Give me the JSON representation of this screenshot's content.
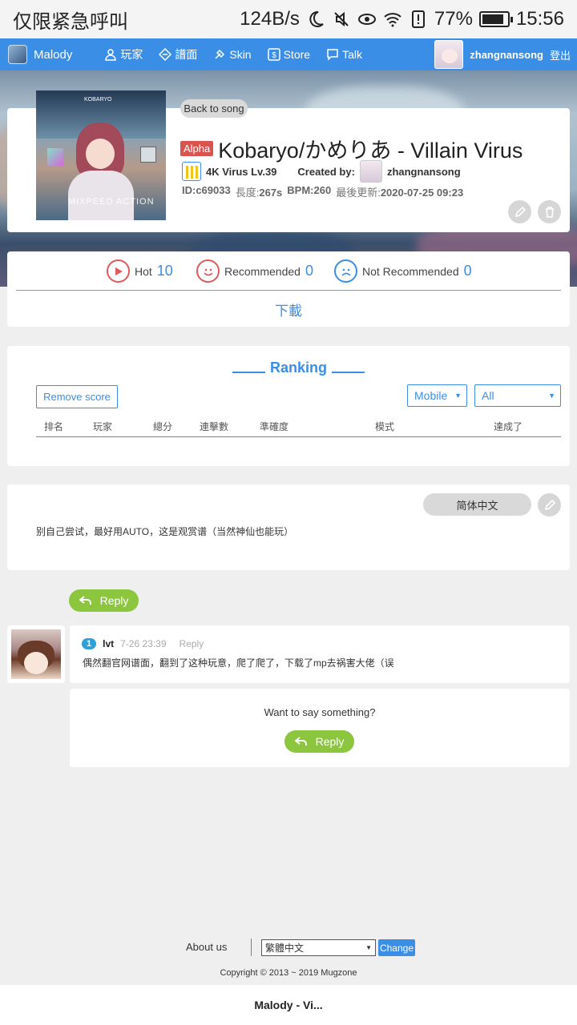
{
  "status_bar": {
    "carrier": "仅限紧急呼叫",
    "speed": "124B/s",
    "battery": "77%",
    "time": "15:56"
  },
  "nav": {
    "brand": "Malody",
    "items": [
      "玩家",
      "譜面",
      "Skin",
      "Store",
      "Talk"
    ],
    "username": "zhangnansong",
    "logout": "登出"
  },
  "song": {
    "back_label": "Back to song",
    "badge": "Alpha",
    "title": "Kobaryo/かめりあ - Villain Virus",
    "mode": "4K Virus Lv.39",
    "created_by_label": "Created by:",
    "creator": "zhangnansong",
    "id": "ID:c69033",
    "length_label": "長度:",
    "length": "267s",
    "bpm": "BPM:260",
    "updated_label": "最後更新:",
    "updated": "2020-07-25 09:23",
    "cover_title": "MIXPEED ACTION",
    "cover_top": "KOBARYO"
  },
  "votes": {
    "hot_label": "Hot",
    "hot_count": "10",
    "rec_label": "Recommended",
    "rec_count": "0",
    "notrec_label": "Not Recommended",
    "notrec_count": "0",
    "download": "下載"
  },
  "ranking": {
    "title": "Ranking",
    "remove_label": "Remove score",
    "platform": "Mobile",
    "filter": "All",
    "columns": [
      "排名",
      "玩家",
      "總分",
      "連擊數",
      "準確度",
      "模式",
      "達成了"
    ]
  },
  "description": {
    "lang_label": "简体中文",
    "text": "别自己尝试，最好用AUTO，这是观赏谱（当然神仙也能玩）"
  },
  "replies": {
    "reply_label": "Reply",
    "comment": {
      "level": "1",
      "user": "lvt",
      "time": "7-26 23:39",
      "reply_link": "Reply",
      "text": "偶然翻官网谱面，翻到了这种玩意，爬了爬了，下载了mp去祸害大佬（误"
    },
    "prompt": "Want to say something?",
    "prompt_reply": "Reply"
  },
  "footer": {
    "about": "About us",
    "language": "繁體中文",
    "change": "Change",
    "copyright": "Copyright © 2013 ~ 2019 Mugzone"
  },
  "bottom_bar": {
    "title": "Malody - Vi..."
  },
  "colors": {
    "primary": "#3a8ee6",
    "alpha_badge": "#d9534f",
    "reply_green": "#8cc63f",
    "hot_red": "#e05a5a"
  }
}
